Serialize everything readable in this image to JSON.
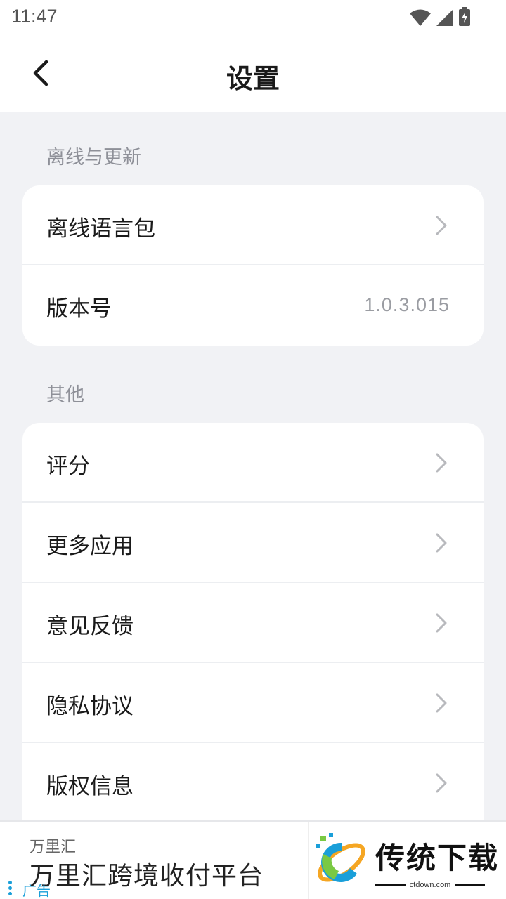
{
  "status_bar": {
    "time": "11:47"
  },
  "header": {
    "title": "设置"
  },
  "sections": [
    {
      "title": "离线与更新",
      "rows": [
        {
          "label": "离线语言包",
          "value": null
        },
        {
          "label": "版本号",
          "value": "1.0.3.015"
        }
      ]
    },
    {
      "title": "其他",
      "rows": [
        {
          "label": "评分"
        },
        {
          "label": "更多应用"
        },
        {
          "label": "意见反馈"
        },
        {
          "label": "隐私协议"
        },
        {
          "label": "版权信息"
        }
      ]
    }
  ],
  "ad": {
    "brand": "万里汇",
    "title": "万里汇跨境收付平台",
    "tag": "广告"
  },
  "watermark": {
    "text": "传统下载",
    "domain": "ctdown.com"
  },
  "icons": {
    "back": "chevron-left-icon",
    "chevron": "chevron-right-icon",
    "wifi": "wifi-icon",
    "signal": "signal-icon",
    "battery": "battery-charging-icon"
  },
  "colors": {
    "background": "#f1f2f5",
    "card": "#ffffff",
    "section_title": "#8e9098",
    "chevron": "#b8b9bd",
    "ad_accent": "#1a9fd9"
  }
}
